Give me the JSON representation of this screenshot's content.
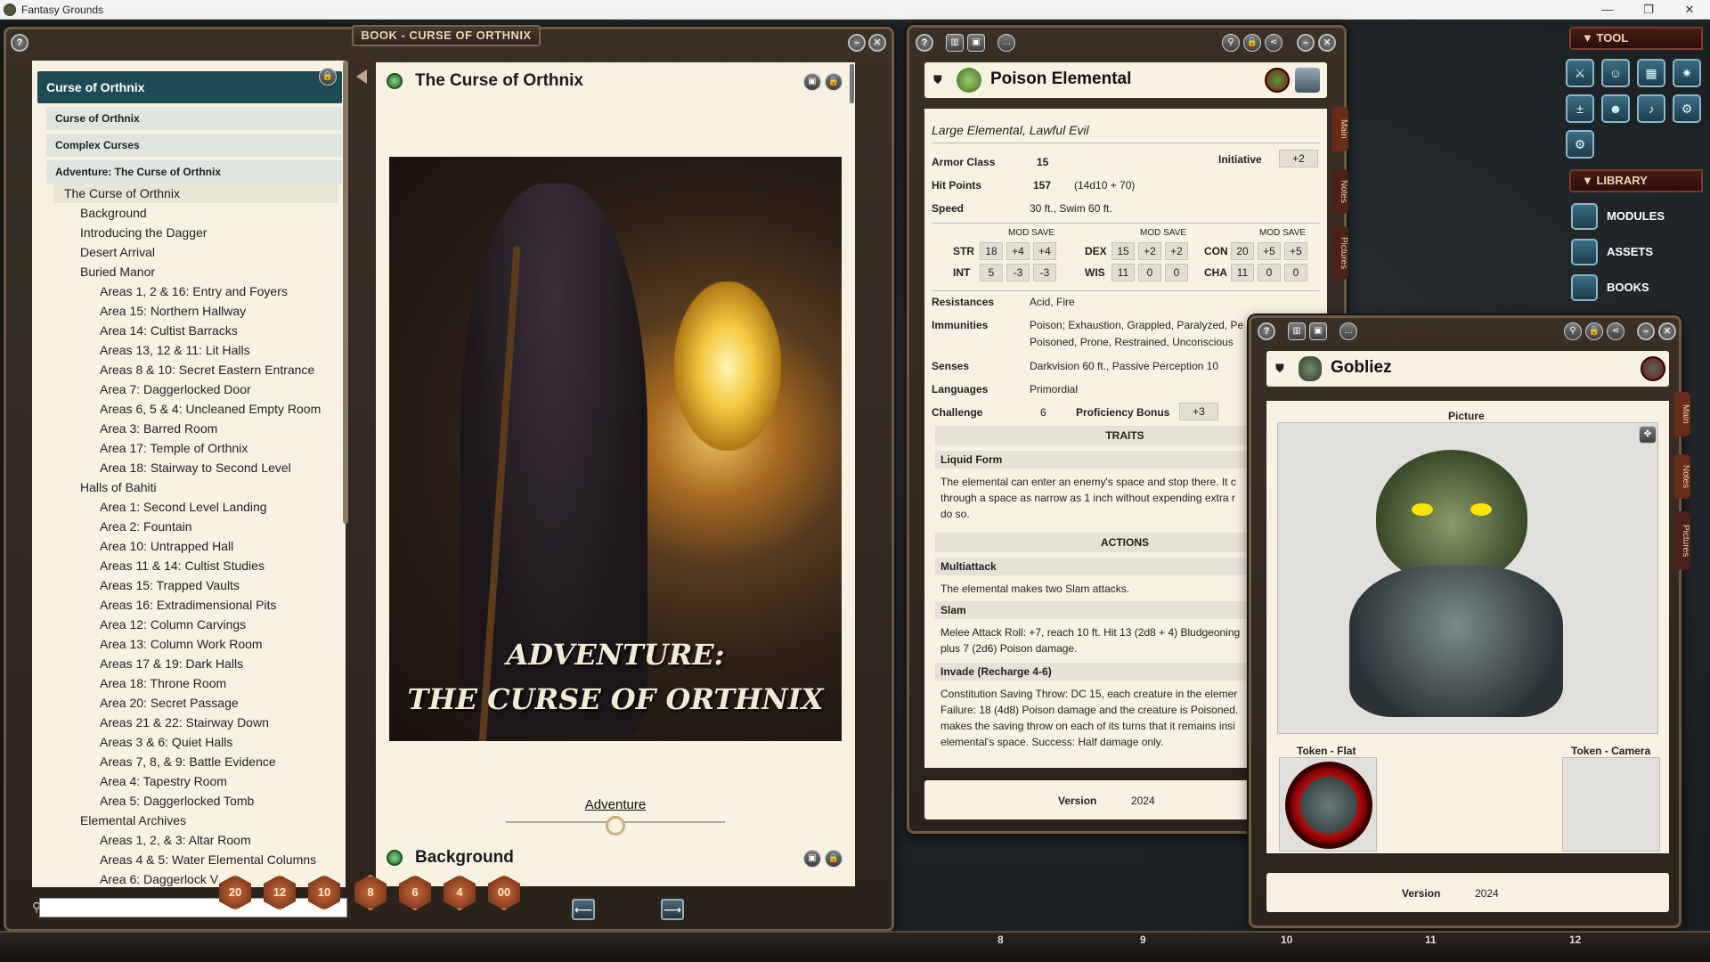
{
  "app_title": "Fantasy Grounds",
  "book": {
    "window_title": "BOOK - CURSE OF ORTHNIX",
    "toc_header": "Curse of Orthnix",
    "toc_subheaders": [
      "Curse of Orthnix",
      "Complex Curses",
      "Adventure: The Curse of Orthnix"
    ],
    "toc_items": [
      {
        "label": "The Curse of Orthnix",
        "level": 0
      },
      {
        "label": "Background",
        "level": 1
      },
      {
        "label": "Introducing the Dagger",
        "level": 1
      },
      {
        "label": "Desert Arrival",
        "level": 1
      },
      {
        "label": "Buried Manor",
        "level": 1
      },
      {
        "label": "Areas 1, 2 & 16: Entry and Foyers",
        "level": 2
      },
      {
        "label": "Area 15: Northern Hallway",
        "level": 2
      },
      {
        "label": "Area 14: Cultist Barracks",
        "level": 2
      },
      {
        "label": "Areas 13, 12 & 11: Lit Halls",
        "level": 2
      },
      {
        "label": "Areas 8 & 10: Secret Eastern Entrance",
        "level": 2
      },
      {
        "label": "Area 7: Daggerlocked Door",
        "level": 2
      },
      {
        "label": "Areas 6, 5 & 4: Uncleaned Empty Room",
        "level": 2
      },
      {
        "label": "Area 3: Barred Room",
        "level": 2
      },
      {
        "label": "Area 17: Temple of Orthnix",
        "level": 2
      },
      {
        "label": "Area 18: Stairway to Second Level",
        "level": 2
      },
      {
        "label": "Halls of Bahiti",
        "level": 1
      },
      {
        "label": "Area 1: Second Level Landing",
        "level": 2
      },
      {
        "label": "Area 2: Fountain",
        "level": 2
      },
      {
        "label": "Area 10: Untrapped Hall",
        "level": 2
      },
      {
        "label": "Areas 11 & 14: Cultist Studies",
        "level": 2
      },
      {
        "label": "Areas 15: Trapped Vaults",
        "level": 2
      },
      {
        "label": "Areas 16: Extradimensional Pits",
        "level": 2
      },
      {
        "label": "Area 12: Column Carvings",
        "level": 2
      },
      {
        "label": "Area 13: Column Work Room",
        "level": 2
      },
      {
        "label": "Areas 17 & 19: Dark Halls",
        "level": 2
      },
      {
        "label": "Area 18: Throne Room",
        "level": 2
      },
      {
        "label": "Area 20: Secret Passage",
        "level": 2
      },
      {
        "label": "Areas 21 & 22: Stairway Down",
        "level": 2
      },
      {
        "label": "Areas 3 & 6: Quiet Halls",
        "level": 2
      },
      {
        "label": "Areas 7, 8, & 9: Battle Evidence",
        "level": 2
      },
      {
        "label": "Area 4: Tapestry Room",
        "level": 2
      },
      {
        "label": "Area 5: Daggerlocked Tomb",
        "level": 2
      },
      {
        "label": "Elemental Archives",
        "level": 1
      },
      {
        "label": "Areas 1, 2, & 3: Altar Room",
        "level": 2
      },
      {
        "label": "Areas 4 & 5: Water Elemental Columns",
        "level": 2
      },
      {
        "label": "Area 6: Daggerlock V",
        "level": 2
      }
    ],
    "page_title": "The Curse of Orthnix",
    "cover_line1": "ADVENTURE:",
    "cover_line2": "THE CURSE OF ORTHNIX",
    "adventure_link": "Adventure",
    "next_section": "Background",
    "dice": [
      "20",
      "12",
      "10",
      "8",
      "6",
      "4",
      "00"
    ]
  },
  "poison_elemental": {
    "name": "Poison Elemental",
    "type": "Large Elemental, Lawful Evil",
    "ac_label": "Armor Class",
    "ac": "15",
    "init_label": "Initiative",
    "init": "+2",
    "hp_label": "Hit Points",
    "hp": "157",
    "hp_dice": "(14d10 + 70)",
    "speed_label": "Speed",
    "speed": "30 ft., Swim 60 ft.",
    "mod_save": "MOD SAVE",
    "abilities": [
      {
        "name": "STR",
        "score": "18",
        "mod": "+4",
        "save": "+4"
      },
      {
        "name": "DEX",
        "score": "15",
        "mod": "+2",
        "save": "+2"
      },
      {
        "name": "CON",
        "score": "20",
        "mod": "+5",
        "save": "+5"
      },
      {
        "name": "INT",
        "score": "5",
        "mod": "-3",
        "save": "-3"
      },
      {
        "name": "WIS",
        "score": "11",
        "mod": "0",
        "save": "0"
      },
      {
        "name": "CHA",
        "score": "11",
        "mod": "0",
        "save": "0"
      }
    ],
    "resist_label": "Resistances",
    "resist": "Acid, Fire",
    "immune_label": "Immunities",
    "immune1": "Poison; Exhaustion, Grappled, Paralyzed, Pe",
    "immune2": "Poisoned, Prone, Restrained, Unconscious",
    "senses_label": "Senses",
    "senses": "Darkvision 60 ft., Passive Perception 10",
    "lang_label": "Languages",
    "lang": "Primordial",
    "cr_label": "Challenge",
    "cr": "6",
    "prof_label": "Proficiency Bonus",
    "prof": "+3",
    "traits_hdr": "TRAITS",
    "trait1": "Liquid Form",
    "trait1_text": [
      "The elemental can enter an enemy's space and stop there. It c",
      "through a space as narrow as 1 inch without expending extra r",
      "do so."
    ],
    "actions_hdr": "ACTIONS",
    "act1": "Multiattack",
    "act1_text": "The elemental makes two Slam attacks.",
    "act2": "Slam",
    "act2_text": [
      "Melee Attack Roll: +7, reach 10 ft. Hit 13 (2d8 + 4) Bludgeoning",
      "plus 7 (2d6) Poison damage."
    ],
    "act3": "Invade (Recharge 4-6)",
    "act3_text": [
      "Constitution Saving Throw: DC 15, each creature in the elemer",
      "Failure: 18 (4d8) Poison damage and the creature is Poisoned.",
      "makes the saving throw on each of its turns that it remains insi",
      "elemental's space. Success: Half damage only."
    ],
    "version_label": "Version",
    "version": "2024",
    "tabs": [
      "Main",
      "Notes",
      "Pictures"
    ]
  },
  "gobliez": {
    "name": "Gobliez",
    "picture_label": "Picture",
    "token_flat": "Token - Flat",
    "token_camera": "Token - Camera",
    "version_label": "Version",
    "version": "2024",
    "tabs": [
      "Main",
      "Notes",
      "Pictures"
    ]
  },
  "sidebar": {
    "tool_label": "TOOL",
    "library_label": "LIBRARY",
    "library_items": [
      "MODULES",
      "ASSETS",
      "BOOKS"
    ]
  },
  "ruler": [
    "8",
    "9",
    "10",
    "11",
    "12"
  ]
}
